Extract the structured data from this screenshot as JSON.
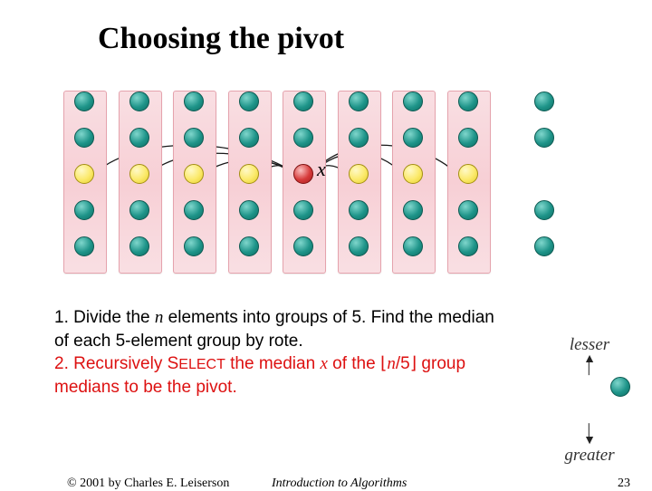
{
  "title": "Choosing the pivot",
  "diagram": {
    "pivot_label": "x",
    "group_count": 8,
    "nodes_per_group": 5
  },
  "body": {
    "step1_num": "1.",
    "step1_a": " Divide the ",
    "n": "n",
    "step1_b": " elements into groups of 5. Find the median of each 5-element group by rote.",
    "step2_num": "2.",
    "step2_a": " Recursively S",
    "select_small": "ELECT",
    "step2_b": " the median ",
    "x": "x",
    "step2_c": " of the ⌊",
    "n2": "n",
    "step2_d": "/5⌋ group medians to be the pivot."
  },
  "legend": {
    "lesser": "lesser",
    "greater": "greater"
  },
  "footer": {
    "copyright": "© 2001 by Charles E. Leiserson",
    "book": "Introduction to Algorithms",
    "page": "23"
  }
}
